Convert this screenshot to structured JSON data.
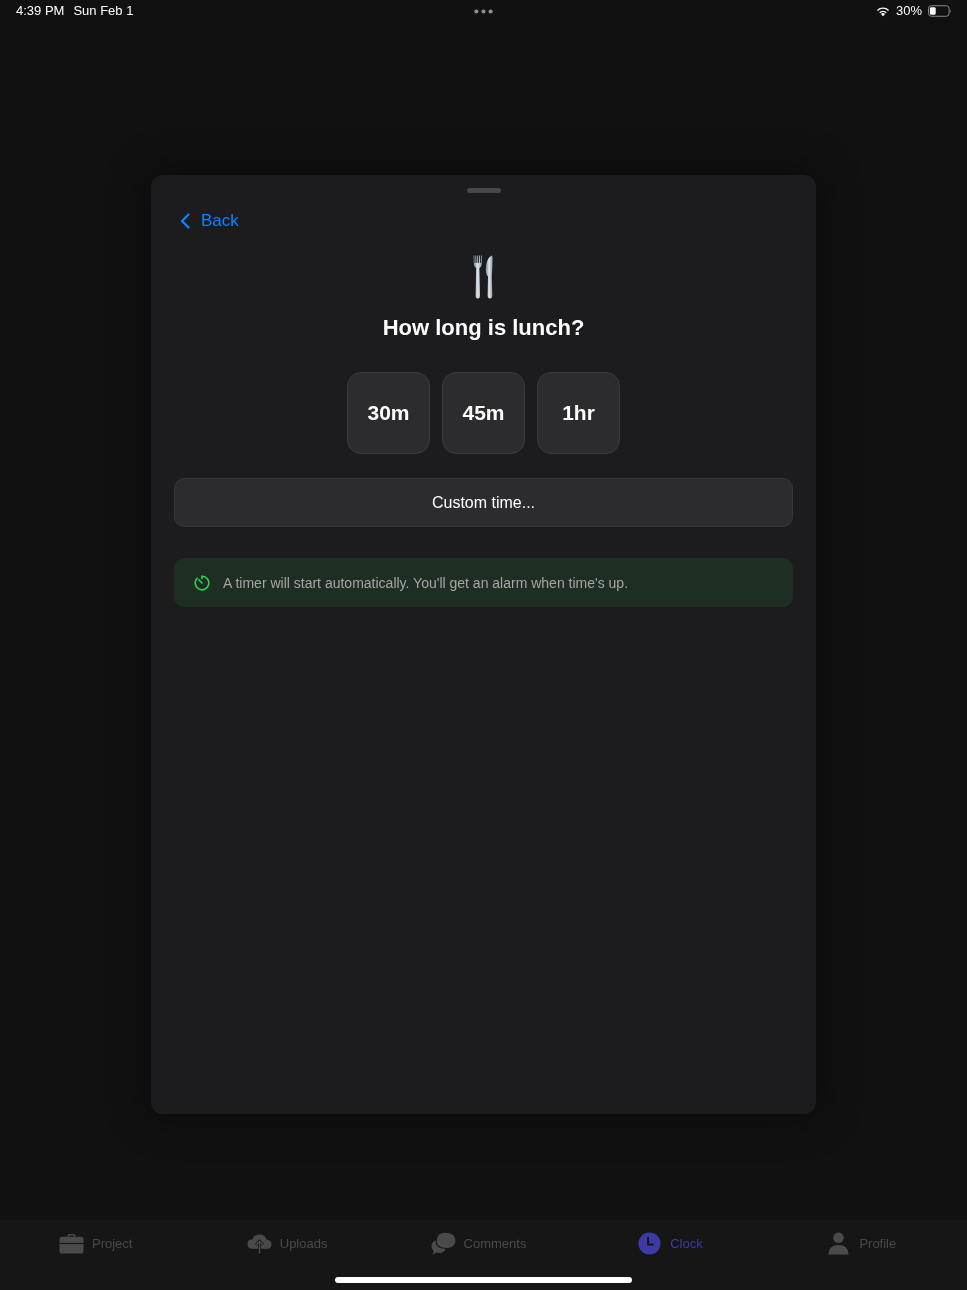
{
  "status_bar": {
    "time": "4:39 PM",
    "date": "Sun Feb 1",
    "battery": "30%"
  },
  "sheet": {
    "back_label": "Back",
    "title": "How long is lunch?",
    "durations": [
      {
        "label": "30m"
      },
      {
        "label": "45m"
      },
      {
        "label": "1hr"
      }
    ],
    "custom_button": "Custom time...",
    "info": "A timer will start automatically. You'll get an alarm when time's up."
  },
  "tab_bar": {
    "items": [
      {
        "label": "Project",
        "selected": false
      },
      {
        "label": "Uploads",
        "selected": false
      },
      {
        "label": "Comments",
        "selected": false
      },
      {
        "label": "Clock",
        "selected": true
      },
      {
        "label": "Profile",
        "selected": false
      }
    ]
  }
}
